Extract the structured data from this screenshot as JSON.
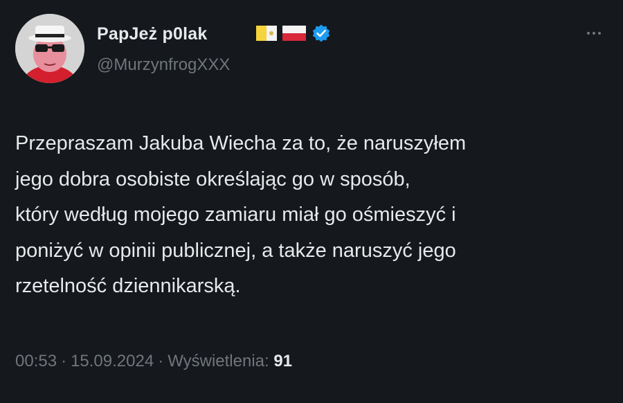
{
  "tweet": {
    "author": {
      "display_name": "PapJeż p0lak",
      "handle": "@MurzynfrogXXX",
      "badges": [
        "vatican-flag-icon",
        "poland-flag-icon",
        "verified-badge-icon"
      ]
    },
    "text_lines": [
      "Przepraszam Jakuba Wiecha za to, że naruszyłem",
      "jego dobra osobiste określając go w sposób,",
      "który według mojego zamiaru miał go ośmieszyć i",
      "poniżyć w opinii publicznej, a także naruszyć jego",
      "rzetelność dziennikarską."
    ],
    "meta": {
      "time": "00:53",
      "separator": "·",
      "date": "15.09.2024",
      "views_label": "Wyświetlenia:",
      "views_count": "91"
    }
  },
  "colors": {
    "background": "#15181d",
    "text_primary": "#e7e9ea",
    "text_secondary": "#71767b",
    "verified_blue": "#1d9bf0"
  }
}
